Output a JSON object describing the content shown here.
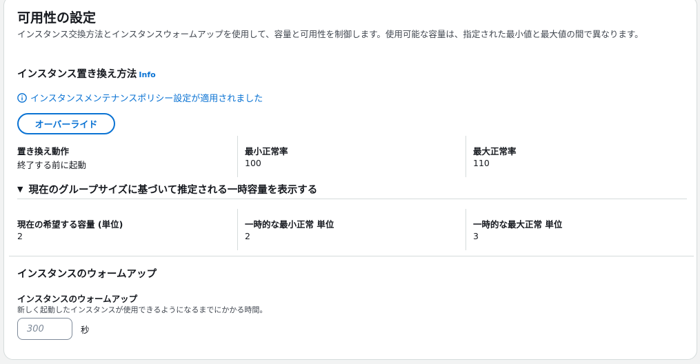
{
  "section": {
    "title": "可用性の設定",
    "description": "インスタンス交換方法とインスタンスウォームアップを使用して、容量と可用性を制御します。使用可能な容量は、指定された最小値と最大値の間で異なります。"
  },
  "replacement": {
    "heading": "インスタンス置き換え方法",
    "info_link": "Info",
    "notice": "インスタンスメンテナンスポリシー設定が適用されました",
    "override_button": "オーバーライド",
    "fields": [
      {
        "label": "置き換え動作",
        "value": "終了する前に起動"
      },
      {
        "label": "最小正常率",
        "value": "100"
      },
      {
        "label": "最大正常率",
        "value": "110"
      }
    ]
  },
  "estimate": {
    "toggle": "現在のグループサイズに基づいて推定される一時容量を表示する",
    "expanded": true,
    "fields": [
      {
        "label": "現在の希望する容量 (単位)",
        "value": "2"
      },
      {
        "label": "一時的な最小正常 単位",
        "value": "2"
      },
      {
        "label": "一時的な最大正常 単位",
        "value": "3"
      }
    ]
  },
  "warmup": {
    "heading": "インスタンスのウォームアップ",
    "field_label": "インスタンスのウォームアップ",
    "field_description": "新しく起動したインスタンスが使用できるようになるまでにかかる時間。",
    "input_placeholder": "300",
    "input_value": "",
    "unit": "秒"
  },
  "colors": {
    "link": "#0972d3",
    "text": "#16191f",
    "divider": "#d5dbdb"
  }
}
